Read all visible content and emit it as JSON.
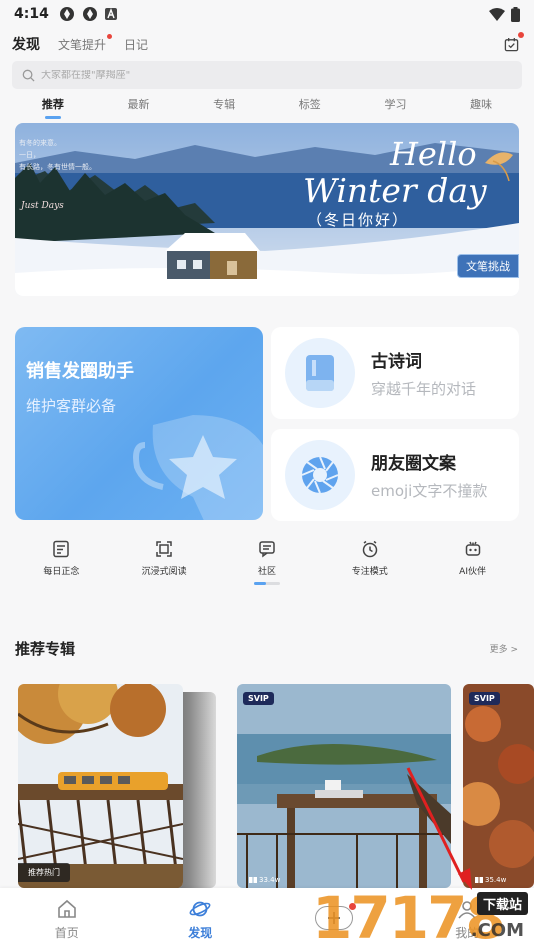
{
  "status_bar": {
    "time": "4:14"
  },
  "top_nav": {
    "tabs": [
      "发现",
      "文笔提升",
      "日记"
    ]
  },
  "search": {
    "placeholder": "大家都在搜\"摩羯座\""
  },
  "category_tabs": [
    "推荐",
    "最新",
    "专辑",
    "标签",
    "学习",
    "趣味"
  ],
  "banner": {
    "poem_lines": [
      "有冬的来意。",
      "一日，",
      "有长路，冬有世情一般。"
    ],
    "signature": "Just Days",
    "hello": "Hello",
    "winter_day": "Winter day",
    "subtitle": "（冬日你好）",
    "button": "文笔挑战"
  },
  "features": {
    "big": {
      "title": "销售发圈助手",
      "subtitle": "维护客群必备"
    },
    "poetry": {
      "title": "古诗词",
      "subtitle": "穿越千年的对话"
    },
    "moments": {
      "title": "朋友圈文案",
      "subtitle": "emoji文字不撞款"
    }
  },
  "quick_tools": [
    {
      "label": "每日正念",
      "icon": "note-icon"
    },
    {
      "label": "沉浸式阅读",
      "icon": "fullscreen-icon"
    },
    {
      "label": "社区",
      "icon": "chat-icon"
    },
    {
      "label": "专注模式",
      "icon": "clock-icon"
    },
    {
      "label": "AI伙伴",
      "icon": "robot-icon"
    }
  ],
  "recommended": {
    "title": "推荐专辑",
    "more": "更多 >",
    "albums": [
      {
        "badge": "推荐热门",
        "svip": "",
        "count": ""
      },
      {
        "badge": "",
        "svip": "SVIP",
        "count": "33.4w"
      },
      {
        "badge": "",
        "svip": "SVIP",
        "count": "35.4w"
      }
    ]
  },
  "bottom_nav": {
    "home": "首页",
    "discover": "发现",
    "mine": "我的"
  },
  "watermark": {
    "number": "17178",
    "box": "下载站",
    "com": ".COM"
  },
  "colors": {
    "accent": "#3d7fd9",
    "badge_red": "#e8453c",
    "card_blue": "#5da6ee"
  }
}
